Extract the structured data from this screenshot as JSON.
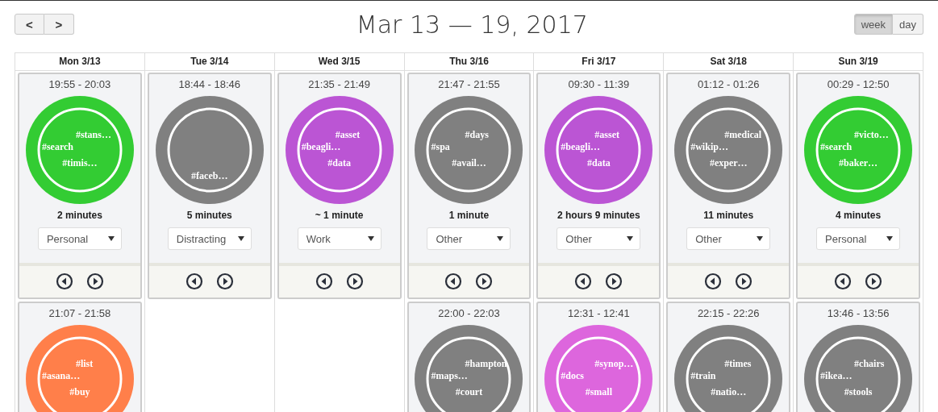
{
  "nav": {
    "prev": "<",
    "next": ">"
  },
  "title": "Mar 13 — 19, 2017",
  "views": [
    {
      "label": "week",
      "selected": true
    },
    {
      "label": "day",
      "selected": false
    }
  ],
  "days": [
    {
      "label": "Mon 3/13",
      "sessions": [
        {
          "time": "19:55 - 20:03",
          "color": "#33cc33",
          "tags": [
            "#stans…",
            "#search",
            "#timis…"
          ],
          "duration": "2 minutes",
          "category": "Personal"
        },
        {
          "time": "21:07 - 21:58",
          "color": "#ff7f4a",
          "tags": [
            "#list",
            "#asana…",
            "#buy"
          ]
        }
      ]
    },
    {
      "label": "Tue 3/14",
      "sessions": [
        {
          "time": "18:44 - 18:46",
          "color": "#808080",
          "tags": [
            "#faceb…"
          ],
          "duration": "5 minutes",
          "category": "Distracting"
        }
      ]
    },
    {
      "label": "Wed 3/15",
      "sessions": [
        {
          "time": "21:35 - 21:49",
          "color": "#bb55d4",
          "tags": [
            "#asset",
            "#beagli…",
            "#data"
          ],
          "duration": "~ 1 minute",
          "category": "Work"
        }
      ]
    },
    {
      "label": "Thu 3/16",
      "sessions": [
        {
          "time": "21:47 - 21:55",
          "color": "#808080",
          "tags": [
            "#days",
            "#spa",
            "#avail…"
          ],
          "duration": "1 minute",
          "category": "Other"
        },
        {
          "time": "22:00 - 22:03",
          "color": "#808080",
          "tags": [
            "#hampton",
            "#maps…",
            "#court"
          ]
        }
      ]
    },
    {
      "label": "Fri 3/17",
      "sessions": [
        {
          "time": "09:30 - 11:39",
          "color": "#bb55d4",
          "tags": [
            "#asset",
            "#beagli…",
            "#data"
          ],
          "duration": "2 hours 9 minutes",
          "category": "Other"
        },
        {
          "time": "12:31 - 12:41",
          "color": "#dd66dd",
          "tags": [
            "#synop…",
            "#docs",
            "#small"
          ]
        }
      ]
    },
    {
      "label": "Sat 3/18",
      "sessions": [
        {
          "time": "01:12 - 01:26",
          "color": "#808080",
          "tags": [
            "#medical",
            "#wikip…",
            "#exper…"
          ],
          "duration": "11 minutes",
          "category": "Other"
        },
        {
          "time": "22:15 - 22:26",
          "color": "#808080",
          "tags": [
            "#times",
            "#train",
            "#natio…"
          ]
        }
      ]
    },
    {
      "label": "Sun 3/19",
      "sessions": [
        {
          "time": "00:29 - 12:50",
          "color": "#33cc33",
          "tags": [
            "#victo…",
            "#search",
            "#baker…"
          ],
          "duration": "4 minutes",
          "category": "Personal"
        },
        {
          "time": "13:46 - 13:56",
          "color": "#808080",
          "tags": [
            "#chairs",
            "#ikea…",
            "#stools"
          ]
        }
      ]
    }
  ]
}
